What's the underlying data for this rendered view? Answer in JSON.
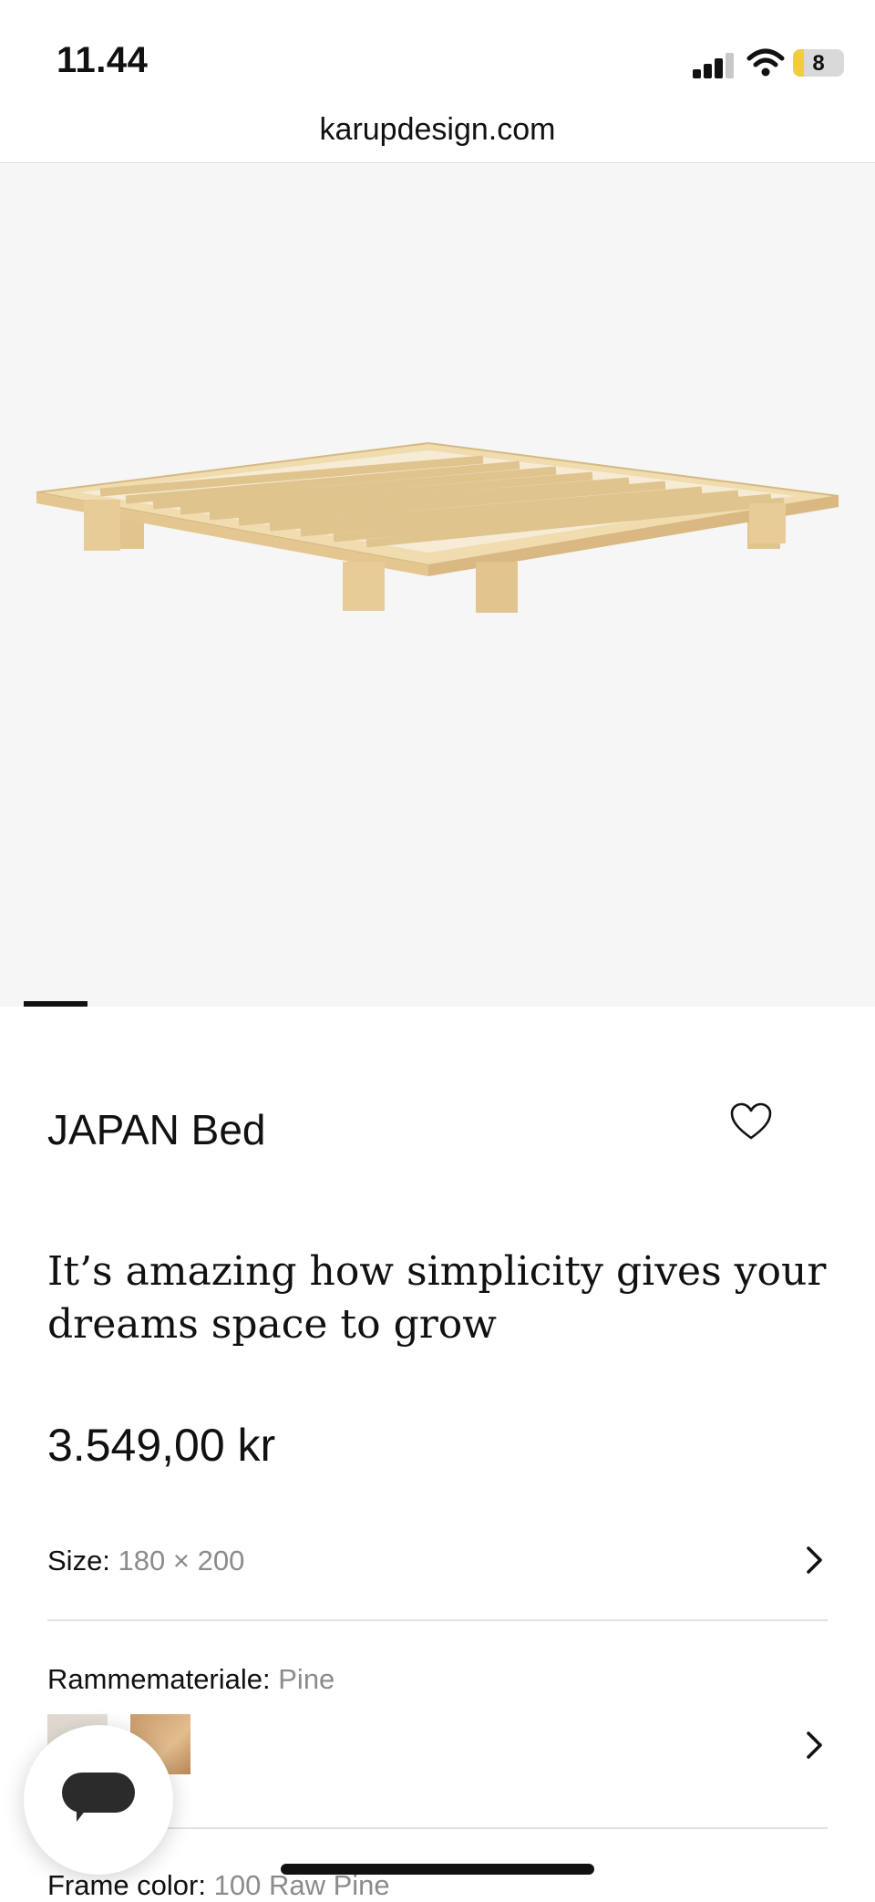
{
  "status_bar": {
    "time": "11.44",
    "battery_level": "8"
  },
  "browser": {
    "url": "karupdesign.com"
  },
  "product": {
    "title": "JAPAN Bed",
    "tagline": "It’s amazing how simplicity gives your dreams space to grow",
    "price": "3.549,00 kr"
  },
  "options": {
    "size": {
      "label": "Size:",
      "value": "180 × 200"
    },
    "frame_material": {
      "label": "Rammemateriale:",
      "value": "Pine"
    },
    "frame_color": {
      "label": "Frame color:",
      "value": "100 Raw Pine"
    }
  },
  "carousel": {
    "active_index": 1
  },
  "icons": [
    "signal-icon",
    "wifi-icon",
    "battery-icon",
    "heart-icon",
    "chevron-right-icon",
    "chat-icon"
  ]
}
